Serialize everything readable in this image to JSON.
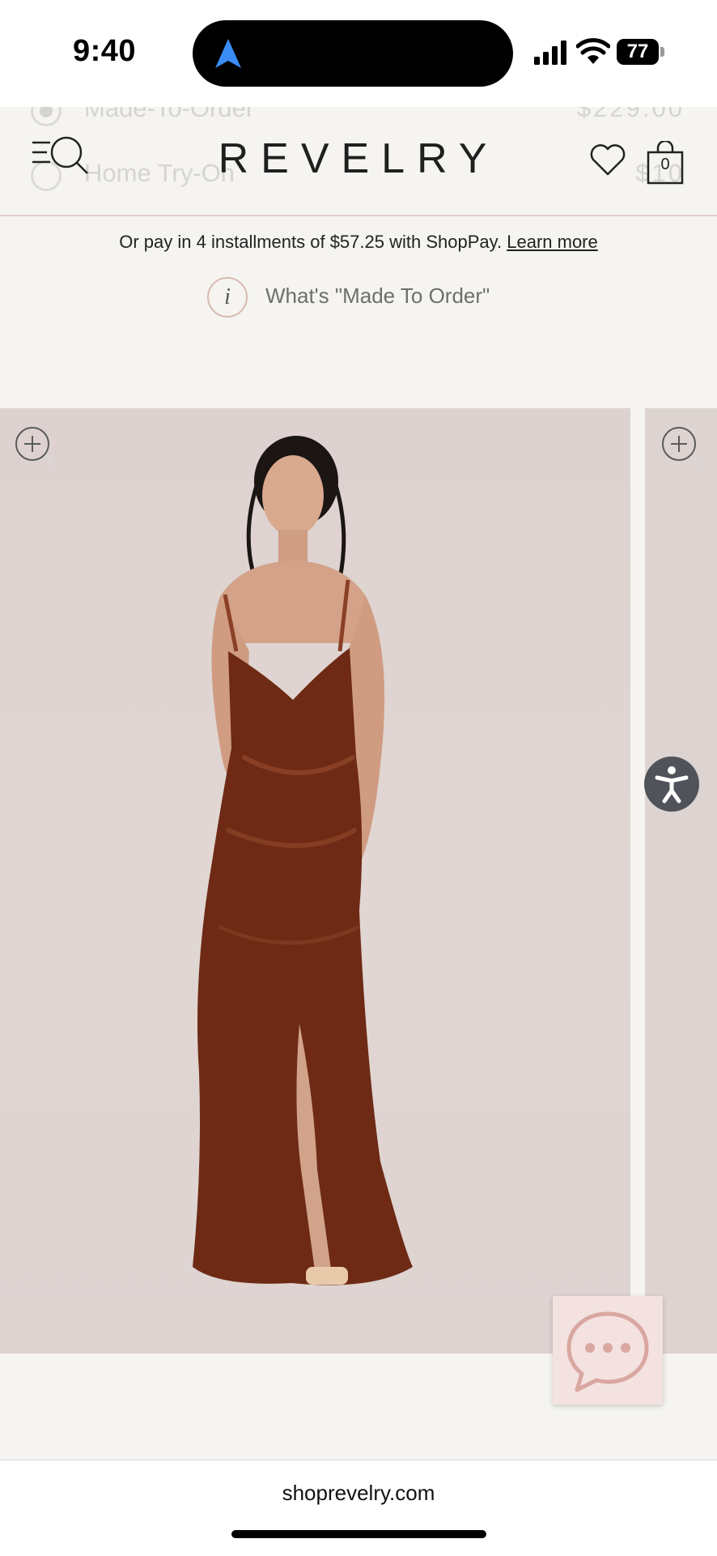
{
  "status_bar": {
    "time": "9:40",
    "battery": "77"
  },
  "header": {
    "ghost_options": [
      {
        "label": "Made-To-Order",
        "price": "$229.00"
      },
      {
        "label": "Home Try-On",
        "price": "$10"
      }
    ],
    "logo": "REVELRY",
    "cart_count": "0"
  },
  "payment": {
    "installment_text": "Or pay in 4 installments of $57.25 with ShopPay.",
    "learn_more": "Learn more",
    "info_icon_glyph": "i",
    "made_to_order_link": "What's \"Made To Order\""
  },
  "browser": {
    "url": "shoprevelry.com"
  },
  "colors": {
    "background": "#f5f4f1",
    "accent_border": "#e3cfc9",
    "dress": "#6e2a14",
    "chat_bg": "#f3e2df",
    "a11y_bg": "#50535a"
  },
  "icons": {
    "menu": "menu-search-icon",
    "wishlist": "heart-icon",
    "cart": "shopping-bag-icon",
    "zoom": "zoom-in-icon",
    "accessibility": "accessibility-icon",
    "chat": "chat-bubble-icon"
  }
}
